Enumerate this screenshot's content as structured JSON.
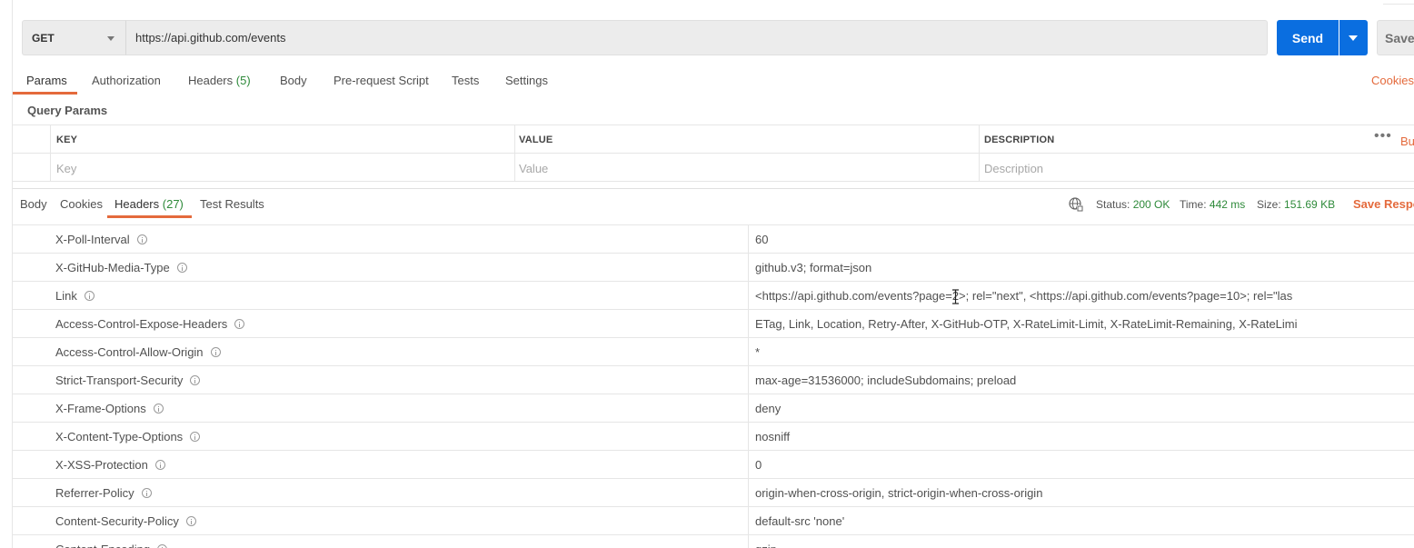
{
  "request": {
    "method": "GET",
    "url": "https://api.github.com/events",
    "send_label": "Send",
    "save_label": "Save"
  },
  "request_tabs": {
    "params": "Params",
    "authorization": "Authorization",
    "headers": "Headers",
    "headers_count": "(5)",
    "body": "Body",
    "pre_request": "Pre-request Script",
    "tests": "Tests",
    "settings": "Settings",
    "cookies": "Cookies"
  },
  "query_params": {
    "title": "Query Params",
    "col_key": "KEY",
    "col_value": "VALUE",
    "col_description": "DESCRIPTION",
    "bulk_edit": "Bu",
    "placeholder_key": "Key",
    "placeholder_value": "Value",
    "placeholder_description": "Description"
  },
  "response_tabs": {
    "body": "Body",
    "cookies": "Cookies",
    "headers": "Headers",
    "headers_count": "(27)",
    "test_results": "Test Results"
  },
  "response_status": {
    "status_label": "Status:",
    "status_value": "200 OK",
    "time_label": "Time:",
    "time_value": "442 ms",
    "size_label": "Size:",
    "size_value": "151.69 KB",
    "save_response": "Save Respo"
  },
  "response_headers": [
    {
      "key": "X-Poll-Interval",
      "value": "60"
    },
    {
      "key": "X-GitHub-Media-Type",
      "value": "github.v3; format=json"
    },
    {
      "key": "Link",
      "value": "<https://api.github.com/events?page=2>; rel=\"next\", <https://api.github.com/events?page=10>; rel=\"las"
    },
    {
      "key": "Access-Control-Expose-Headers",
      "value": "ETag, Link, Location, Retry-After, X-GitHub-OTP, X-RateLimit-Limit, X-RateLimit-Remaining, X-RateLimi"
    },
    {
      "key": "Access-Control-Allow-Origin",
      "value": "*"
    },
    {
      "key": "Strict-Transport-Security",
      "value": "max-age=31536000; includeSubdomains; preload"
    },
    {
      "key": "X-Frame-Options",
      "value": "deny"
    },
    {
      "key": "X-Content-Type-Options",
      "value": "nosniff"
    },
    {
      "key": "X-XSS-Protection",
      "value": "0"
    },
    {
      "key": "Referrer-Policy",
      "value": "origin-when-cross-origin, strict-origin-when-cross-origin"
    },
    {
      "key": "Content-Security-Policy",
      "value": "default-src 'none'"
    },
    {
      "key": "Content-Encoding",
      "value": "gzip"
    }
  ]
}
